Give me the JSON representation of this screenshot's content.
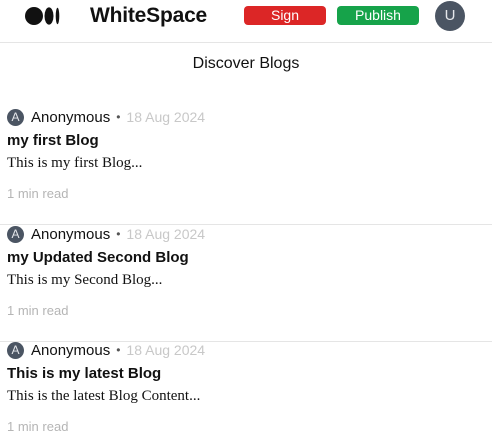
{
  "header": {
    "brand": "WhiteSpace",
    "sign_label": "Sign",
    "publish_label": "Publish",
    "avatar_initial": "U",
    "colors": {
      "sign": "#dc2626",
      "publish": "#16a34a",
      "avatar": "#4b5563"
    }
  },
  "page_title": "Discover Blogs",
  "posts": [
    {
      "avatar_initial": "A",
      "author": "Anonymous",
      "separator": "•",
      "date": "18 Aug 2024",
      "title": "my first Blog",
      "excerpt": "This is my first Blog...",
      "read_time": "1 min read"
    },
    {
      "avatar_initial": "A",
      "author": "Anonymous",
      "separator": "•",
      "date": "18 Aug 2024",
      "title": "my Updated Second Blog",
      "excerpt": "This is my Second Blog...",
      "read_time": "1 min read"
    },
    {
      "avatar_initial": "A",
      "author": "Anonymous",
      "separator": "•",
      "date": "18 Aug 2024",
      "title": "This is my latest Blog",
      "excerpt": "This is the latest Blog Content...",
      "read_time": "1 min read"
    }
  ]
}
